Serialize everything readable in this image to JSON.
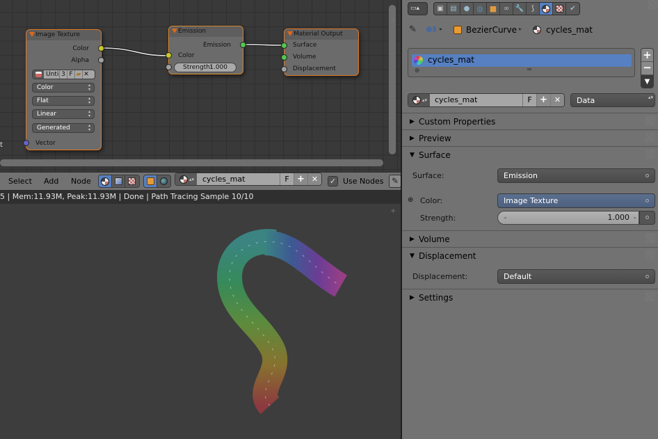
{
  "node_editor": {
    "nodes": {
      "image_texture": {
        "title": "Image Texture",
        "outputs": [
          "Color",
          "Alpha"
        ],
        "image_name": "Unti",
        "users": "3",
        "fake_user": "F",
        "dropdowns": [
          "Color",
          "Flat",
          "Linear",
          "Generated"
        ],
        "inputs": [
          "Vector"
        ]
      },
      "emission": {
        "title": "Emission",
        "outputs": [
          "Emission"
        ],
        "inputs": [
          "Color"
        ],
        "strength_label": "Strength:",
        "strength_value": "1.000"
      },
      "material_output": {
        "title": "Material Output",
        "inputs": [
          "Surface",
          "Volume",
          "Displacement"
        ]
      }
    },
    "left_edge_text": "t"
  },
  "node_header": {
    "menus": [
      "Select",
      "Add",
      "Node"
    ],
    "material_name": "cycles_mat",
    "fake_user": "F",
    "use_nodes_label": "Use Nodes",
    "use_nodes_checked": true
  },
  "status_bar": {
    "text": "5 | Mem:11.93M, Peak:11.93M | Done | Path Tracing Sample 10/10"
  },
  "properties": {
    "breadcrumb": [
      "BezierCurve",
      "cycles_mat"
    ],
    "material_slots": [
      {
        "name": "cycles_mat",
        "selected": true
      }
    ],
    "material_name": "cycles_mat",
    "fake_user": "F",
    "link_dropdown": "Data",
    "panels": [
      {
        "title": "Custom Properties",
        "expanded": false
      },
      {
        "title": "Preview",
        "expanded": false
      },
      {
        "title": "Surface",
        "expanded": true
      },
      {
        "title": "Volume",
        "expanded": false
      },
      {
        "title": "Displacement",
        "expanded": true
      },
      {
        "title": "Settings",
        "expanded": false
      }
    ],
    "surface": {
      "surface_label": "Surface:",
      "surface_value": "Emission",
      "color_label": "Color:",
      "color_value": "Image Texture",
      "strength_label": "Strength:",
      "strength_value": "1.000"
    },
    "displacement": {
      "label": "Displacement:",
      "value": "Default"
    }
  },
  "colors": {
    "node_border_active": "#e5781f",
    "selection_blue": "#5680c2",
    "socket_color": "#c8c82a",
    "socket_shader": "#53c64d",
    "socket_vector": "#6363c7"
  }
}
